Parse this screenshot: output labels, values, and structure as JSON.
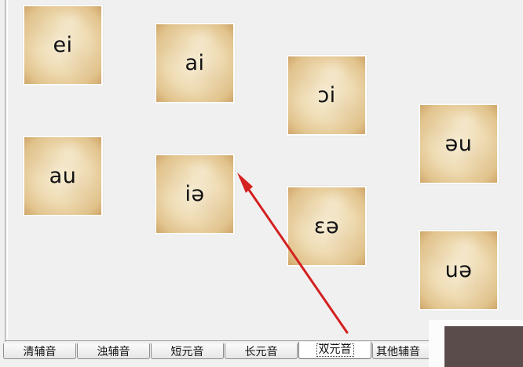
{
  "cards": [
    {
      "id": "ei",
      "label": "ei"
    },
    {
      "id": "ai",
      "label": "ai"
    },
    {
      "id": "oi",
      "label": "ɔi"
    },
    {
      "id": "au",
      "label": "au"
    },
    {
      "id": "ie",
      "label": "iə"
    },
    {
      "id": "eue",
      "label": "əu"
    },
    {
      "id": "ea",
      "label": "ɛə"
    },
    {
      "id": "ue",
      "label": "uə"
    }
  ],
  "tabs": [
    {
      "label": "清辅音",
      "active": false
    },
    {
      "label": "浊辅音",
      "active": false
    },
    {
      "label": "短元音",
      "active": false
    },
    {
      "label": "长元音",
      "active": false
    },
    {
      "label": "双元音",
      "active": true
    },
    {
      "label": "其他辅音",
      "active": false
    }
  ],
  "annotation": {
    "color": "#d42020"
  }
}
